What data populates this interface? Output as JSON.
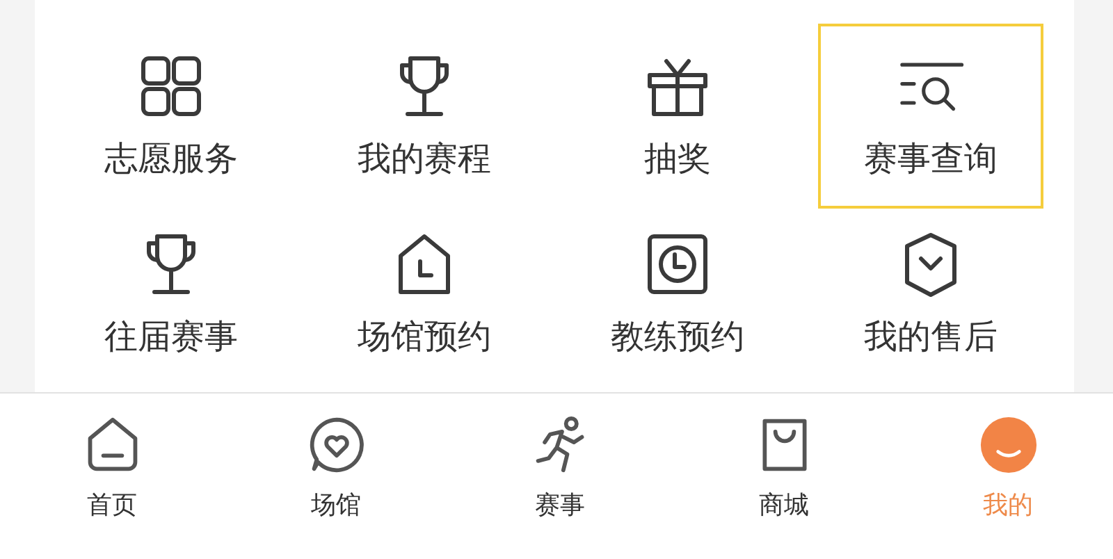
{
  "services": [
    {
      "kind": "grid",
      "label": "志愿服务",
      "highlighted": false
    },
    {
      "kind": "trophy",
      "label": "我的赛程",
      "highlighted": false
    },
    {
      "kind": "gift",
      "label": "抽奖",
      "highlighted": false
    },
    {
      "kind": "search-list",
      "label": "赛事查询",
      "highlighted": true
    },
    {
      "kind": "trophy",
      "label": "往届赛事",
      "highlighted": false
    },
    {
      "kind": "house-clock",
      "label": "场馆预约",
      "highlighted": false
    },
    {
      "kind": "square-clock",
      "label": "教练预约",
      "highlighted": false
    },
    {
      "kind": "shield",
      "label": "我的售后",
      "highlighted": false
    }
  ],
  "tab_bar": [
    {
      "kind": "home",
      "label": "首页",
      "selected": false
    },
    {
      "kind": "heart-bubble",
      "label": "场馆",
      "selected": false
    },
    {
      "kind": "runner",
      "label": "赛事",
      "selected": false
    },
    {
      "kind": "bag",
      "label": "商城",
      "selected": false
    },
    {
      "kind": "smile",
      "label": "我的",
      "selected": true
    }
  ]
}
